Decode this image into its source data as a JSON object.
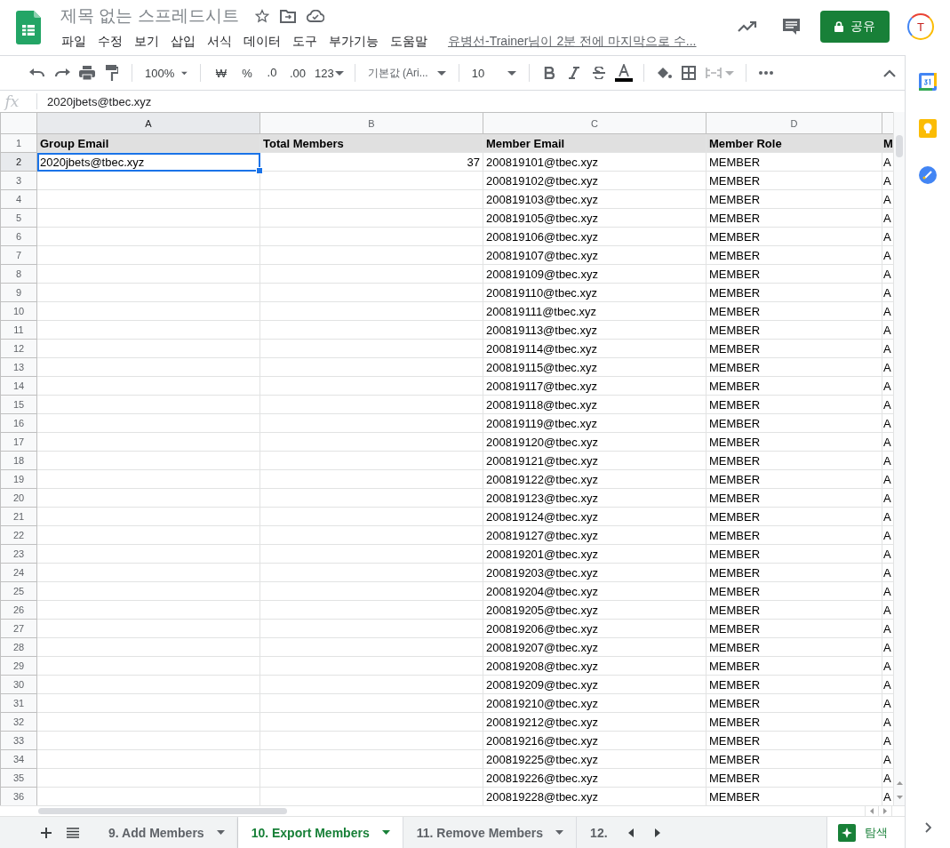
{
  "app": {
    "title": "제목 없는 스프레드시트",
    "menu": [
      "파일",
      "수정",
      "보기",
      "삽입",
      "서식",
      "데이터",
      "도구",
      "부가기능",
      "도움말"
    ],
    "last_edit": "유병선-Trainer님이 2분 전에 마지막으로 수...",
    "share": "공유",
    "avatar": "T"
  },
  "toolbar": {
    "zoom": "100%",
    "currency": "₩",
    "percent": "%",
    "decrease_decimal": ".0",
    "increase_decimal": ".00",
    "number_format": "123",
    "font": "기본값 (Ari...",
    "font_size": "10"
  },
  "formula_bar": {
    "label": "fx",
    "value": "2020jbets@tbec.xyz"
  },
  "columns": [
    {
      "letter": "A",
      "selected": true,
      "numeric": false
    },
    {
      "letter": "B",
      "selected": false,
      "numeric": true
    },
    {
      "letter": "C",
      "selected": false,
      "numeric": false
    },
    {
      "letter": "D",
      "selected": false,
      "numeric": false
    },
    {
      "selected": false,
      "numeric": false
    }
  ],
  "rows": [
    {
      "number": "1",
      "kind": "header",
      "selected": false,
      "cells": {
        "a": "Group Email",
        "b": "Total Members",
        "c": "Member Email",
        "d": "Member Role",
        "e": "M"
      }
    },
    {
      "number": "2",
      "kind": "data",
      "selected": true,
      "cells": {
        "a": "2020jbets@tbec.xyz",
        "b": "37",
        "c": "200819101@tbec.xyz",
        "d": "MEMBER",
        "e": "A"
      }
    },
    {
      "number": "3",
      "kind": "data",
      "selected": false,
      "cells": {
        "c": "200819102@tbec.xyz",
        "d": "MEMBER",
        "e": "A"
      }
    },
    {
      "number": "4",
      "kind": "data",
      "selected": false,
      "cells": {
        "c": "200819103@tbec.xyz",
        "d": "MEMBER",
        "e": "A"
      }
    },
    {
      "number": "5",
      "kind": "data",
      "selected": false,
      "cells": {
        "c": "200819105@tbec.xyz",
        "d": "MEMBER",
        "e": "A"
      }
    },
    {
      "number": "6",
      "kind": "data",
      "selected": false,
      "cells": {
        "c": "200819106@tbec.xyz",
        "d": "MEMBER",
        "e": "A"
      }
    },
    {
      "number": "7",
      "kind": "data",
      "selected": false,
      "cells": {
        "c": "200819107@tbec.xyz",
        "d": "MEMBER",
        "e": "A"
      }
    },
    {
      "number": "8",
      "kind": "data",
      "selected": false,
      "cells": {
        "c": "200819109@tbec.xyz",
        "d": "MEMBER",
        "e": "A"
      }
    },
    {
      "number": "9",
      "kind": "data",
      "selected": false,
      "cells": {
        "c": "200819110@tbec.xyz",
        "d": "MEMBER",
        "e": "A"
      }
    },
    {
      "number": "10",
      "kind": "data",
      "selected": false,
      "cells": {
        "c": "200819111@tbec.xyz",
        "d": "MEMBER",
        "e": "A"
      }
    },
    {
      "number": "11",
      "kind": "data",
      "selected": false,
      "cells": {
        "c": "200819113@tbec.xyz",
        "d": "MEMBER",
        "e": "A"
      }
    },
    {
      "number": "12",
      "kind": "data",
      "selected": false,
      "cells": {
        "c": "200819114@tbec.xyz",
        "d": "MEMBER",
        "e": "A"
      }
    },
    {
      "number": "13",
      "kind": "data",
      "selected": false,
      "cells": {
        "c": "200819115@tbec.xyz",
        "d": "MEMBER",
        "e": "A"
      }
    },
    {
      "number": "14",
      "kind": "data",
      "selected": false,
      "cells": {
        "c": "200819117@tbec.xyz",
        "d": "MEMBER",
        "e": "A"
      }
    },
    {
      "number": "15",
      "kind": "data",
      "selected": false,
      "cells": {
        "c": "200819118@tbec.xyz",
        "d": "MEMBER",
        "e": "A"
      }
    },
    {
      "number": "16",
      "kind": "data",
      "selected": false,
      "cells": {
        "c": "200819119@tbec.xyz",
        "d": "MEMBER",
        "e": "A"
      }
    },
    {
      "number": "17",
      "kind": "data",
      "selected": false,
      "cells": {
        "c": "200819120@tbec.xyz",
        "d": "MEMBER",
        "e": "A"
      }
    },
    {
      "number": "18",
      "kind": "data",
      "selected": false,
      "cells": {
        "c": "200819121@tbec.xyz",
        "d": "MEMBER",
        "e": "A"
      }
    },
    {
      "number": "19",
      "kind": "data",
      "selected": false,
      "cells": {
        "c": "200819122@tbec.xyz",
        "d": "MEMBER",
        "e": "A"
      }
    },
    {
      "number": "20",
      "kind": "data",
      "selected": false,
      "cells": {
        "c": "200819123@tbec.xyz",
        "d": "MEMBER",
        "e": "A"
      }
    },
    {
      "number": "21",
      "kind": "data",
      "selected": false,
      "cells": {
        "c": "200819124@tbec.xyz",
        "d": "MEMBER",
        "e": "A"
      }
    },
    {
      "number": "22",
      "kind": "data",
      "selected": false,
      "cells": {
        "c": "200819127@tbec.xyz",
        "d": "MEMBER",
        "e": "A"
      }
    },
    {
      "number": "23",
      "kind": "data",
      "selected": false,
      "cells": {
        "c": "200819201@tbec.xyz",
        "d": "MEMBER",
        "e": "A"
      }
    },
    {
      "number": "24",
      "kind": "data",
      "selected": false,
      "cells": {
        "c": "200819203@tbec.xyz",
        "d": "MEMBER",
        "e": "A"
      }
    },
    {
      "number": "25",
      "kind": "data",
      "selected": false,
      "cells": {
        "c": "200819204@tbec.xyz",
        "d": "MEMBER",
        "e": "A"
      }
    },
    {
      "number": "26",
      "kind": "data",
      "selected": false,
      "cells": {
        "c": "200819205@tbec.xyz",
        "d": "MEMBER",
        "e": "A"
      }
    },
    {
      "number": "27",
      "kind": "data",
      "selected": false,
      "cells": {
        "c": "200819206@tbec.xyz",
        "d": "MEMBER",
        "e": "A"
      }
    },
    {
      "number": "28",
      "kind": "data",
      "selected": false,
      "cells": {
        "c": "200819207@tbec.xyz",
        "d": "MEMBER",
        "e": "A"
      }
    },
    {
      "number": "29",
      "kind": "data",
      "selected": false,
      "cells": {
        "c": "200819208@tbec.xyz",
        "d": "MEMBER",
        "e": "A"
      }
    },
    {
      "number": "30",
      "kind": "data",
      "selected": false,
      "cells": {
        "c": "200819209@tbec.xyz",
        "d": "MEMBER",
        "e": "A"
      }
    },
    {
      "number": "31",
      "kind": "data",
      "selected": false,
      "cells": {
        "c": "200819210@tbec.xyz",
        "d": "MEMBER",
        "e": "A"
      }
    },
    {
      "number": "32",
      "kind": "data",
      "selected": false,
      "cells": {
        "c": "200819212@tbec.xyz",
        "d": "MEMBER",
        "e": "A"
      }
    },
    {
      "number": "33",
      "kind": "data",
      "selected": false,
      "cells": {
        "c": "200819216@tbec.xyz",
        "d": "MEMBER",
        "e": "A"
      }
    },
    {
      "number": "34",
      "kind": "data",
      "selected": false,
      "cells": {
        "c": "200819225@tbec.xyz",
        "d": "MEMBER",
        "e": "A"
      }
    },
    {
      "number": "35",
      "kind": "data",
      "selected": false,
      "cells": {
        "c": "200819226@tbec.xyz",
        "d": "MEMBER",
        "e": "A"
      }
    },
    {
      "number": "36",
      "kind": "data",
      "selected": false,
      "cells": {
        "c": "200819228@tbec.xyz",
        "d": "MEMBER",
        "e": "A"
      }
    }
  ],
  "sheet_tabs": [
    {
      "label": "9. Add Members",
      "selected": false
    },
    {
      "label": "10. Export Members",
      "selected": true
    },
    {
      "label": "11. Remove Members",
      "selected": false
    },
    {
      "label": "12.",
      "selected": false
    }
  ],
  "explore": "탐색"
}
